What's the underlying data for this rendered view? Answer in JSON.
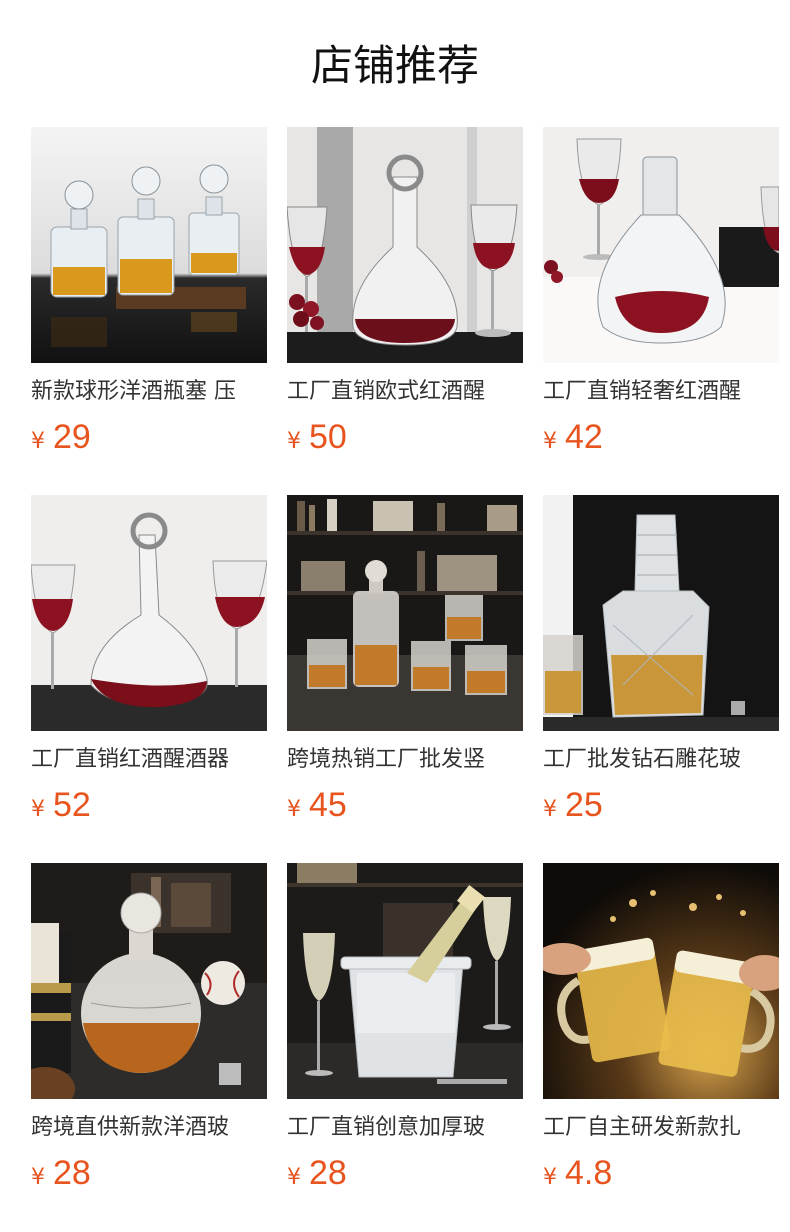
{
  "section": {
    "title": "店铺推荐"
  },
  "currency_symbol": "¥",
  "colors": {
    "price": "#e8541e",
    "title": "#111111",
    "name": "#333333"
  },
  "products": [
    {
      "name": "新款球形洋酒瓶塞 压",
      "price": "29",
      "image": "three-whisky-decanters-with-globe-stoppers"
    },
    {
      "name": "工厂直销欧式红酒醒",
      "price": "50",
      "image": "red-wine-decanter-with-ring-stopper"
    },
    {
      "name": "工厂直销轻奢红酒醒",
      "price": "42",
      "image": "wide-base-wine-decanter"
    },
    {
      "name": "工厂直销红酒醒酒器",
      "price": "52",
      "image": "tilted-red-wine-decanter"
    },
    {
      "name": "跨境热销工厂批发竖",
      "price": "45",
      "image": "whisky-decanter-set-with-glasses"
    },
    {
      "name": "工厂批发钻石雕花玻",
      "price": "25",
      "image": "crystal-iceberg-decanter"
    },
    {
      "name": "跨境直供新款洋酒玻",
      "price": "28",
      "image": "baseball-globe-decanter"
    },
    {
      "name": "工厂直销创意加厚玻",
      "price": "28",
      "image": "ice-bucket-with-champagne"
    },
    {
      "name": "工厂自主研发新款扎",
      "price": "4.8",
      "image": "beer-mugs-toast"
    }
  ]
}
